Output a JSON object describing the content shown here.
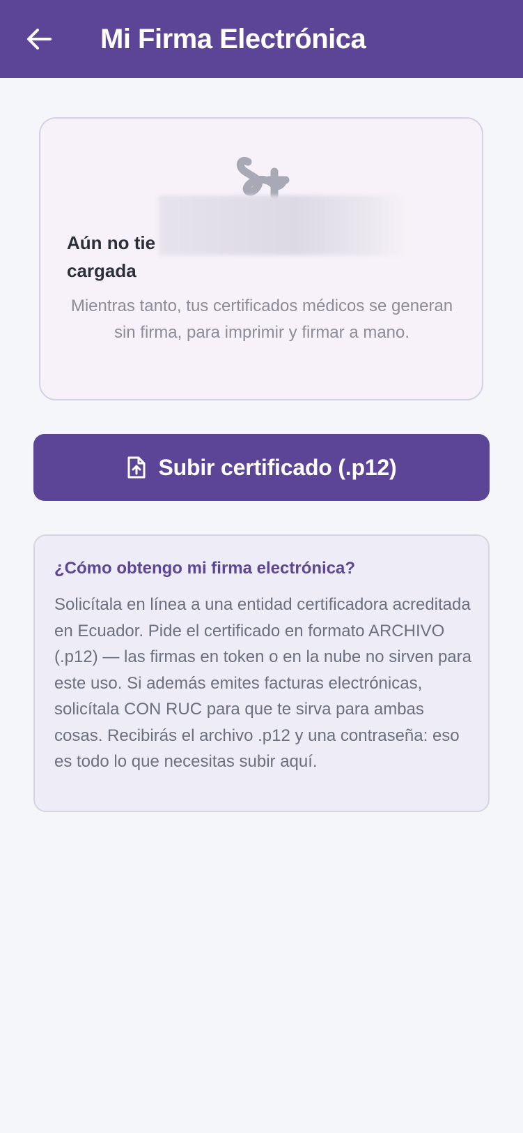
{
  "appbar": {
    "title": "Mi Firma Electrónica",
    "back_icon": "arrow-left-icon"
  },
  "status_card": {
    "icon": "signature-icon",
    "title": "Aún no tie cargada",
    "title_line1": "Aún no tie",
    "title_line2": "cargada",
    "description": "Mientras tanto, tus certificados médicos se generan sin firma, para imprimir y firmar a mano."
  },
  "upload_button": {
    "icon": "file-upload-icon",
    "label": "Subir certificado (.p12)"
  },
  "info_card": {
    "title": "¿Cómo obtengo mi firma electrónica?",
    "body": "Solicítala en línea a una entidad certificadora acreditada en Ecuador. Pide el certificado en formato ARCHIVO (.p12) — las firmas en token o en la nube no sirven para este uso. Si además emites facturas electrónicas, solicítala CON RUC para que te sirva para ambas cosas. Recibirás el archivo .p12 y una contraseña: eso es todo lo que necesitas subir aquí."
  },
  "colors": {
    "primary": "#5c4596",
    "background": "#f5f6fa",
    "card": "#f7f2f9",
    "info_card": "#eeecf6"
  }
}
